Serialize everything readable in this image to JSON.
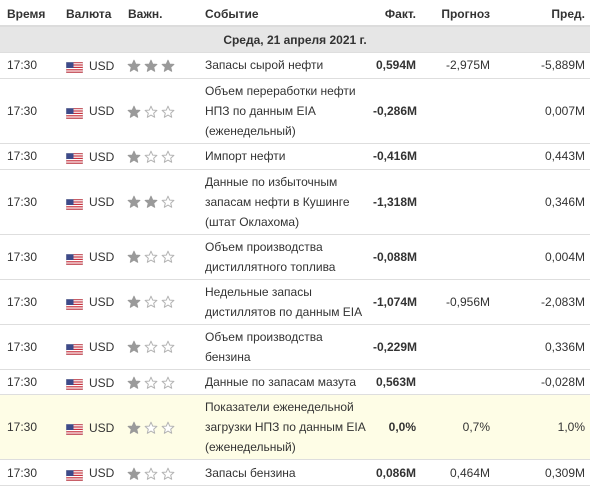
{
  "header": {
    "time": "Время",
    "currency": "Валюта",
    "importance": "Важн.",
    "event": "Событие",
    "actual": "Факт.",
    "forecast": "Прогноз",
    "previous": "Пред."
  },
  "date_label": "Среда, 21 апреля 2021 г.",
  "colors": {
    "positive": "#2c9c14",
    "negative": "#e4141b",
    "neutral": "#111111",
    "highlight_row": "#fefde6",
    "date_bar": "#e6e6e6"
  },
  "events": [
    {
      "time": "17:30",
      "currency": "USD",
      "flag_icon": "us-flag-icon",
      "importance": 3,
      "event": "Запасы сырой нефти",
      "actual": "0,594M",
      "actual_color": "negative",
      "forecast": "-2,975M",
      "previous": "-5,889M",
      "highlighted": false
    },
    {
      "time": "17:30",
      "currency": "USD",
      "flag_icon": "us-flag-icon",
      "importance": 1,
      "event": "Объем переработки нефти НПЗ по данным EIA (еженедельный)",
      "actual": "-0,286M",
      "actual_color": "neutral",
      "forecast": "",
      "previous": "0,007M",
      "highlighted": false
    },
    {
      "time": "17:30",
      "currency": "USD",
      "flag_icon": "us-flag-icon",
      "importance": 1,
      "event": "Импорт нефти",
      "actual": "-0,416M",
      "actual_color": "neutral",
      "forecast": "",
      "previous": "0,443M",
      "highlighted": false
    },
    {
      "time": "17:30",
      "currency": "USD",
      "flag_icon": "us-flag-icon",
      "importance": 2,
      "event": "Данные по избыточным запасам нефти в Кушинге (штат Оклахома)",
      "actual": "-1,318M",
      "actual_color": "neutral",
      "forecast": "",
      "previous": "0,346M",
      "highlighted": false
    },
    {
      "time": "17:30",
      "currency": "USD",
      "flag_icon": "us-flag-icon",
      "importance": 1,
      "event": "Объем производства дистиллятного топлива",
      "actual": "-0,088M",
      "actual_color": "neutral",
      "forecast": "",
      "previous": "0,004M",
      "highlighted": false
    },
    {
      "time": "17:30",
      "currency": "USD",
      "flag_icon": "us-flag-icon",
      "importance": 1,
      "event": "Недельные запасы дистиллятов по данным EIA",
      "actual": "-1,074M",
      "actual_color": "positive",
      "forecast": "-0,956M",
      "previous": "-2,083M",
      "highlighted": false
    },
    {
      "time": "17:30",
      "currency": "USD",
      "flag_icon": "us-flag-icon",
      "importance": 1,
      "event": "Объем производства бензина",
      "actual": "-0,229M",
      "actual_color": "neutral",
      "forecast": "",
      "previous": "0,336M",
      "highlighted": false
    },
    {
      "time": "17:30",
      "currency": "USD",
      "flag_icon": "us-flag-icon",
      "importance": 1,
      "event": "Данные по запасам мазута",
      "actual": "0,563M",
      "actual_color": "neutral",
      "forecast": "",
      "previous": "-0,028M",
      "highlighted": false
    },
    {
      "time": "17:30",
      "currency": "USD",
      "flag_icon": "us-flag-icon",
      "importance": 1,
      "event": "Показатели еженедельной загрузки НПЗ по данным EIA (еженедельный)",
      "actual": "0,0%",
      "actual_color": "negative",
      "forecast": "0,7%",
      "previous": "1,0%",
      "highlighted": true
    },
    {
      "time": "17:30",
      "currency": "USD",
      "flag_icon": "us-flag-icon",
      "importance": 1,
      "event": "Запасы бензина",
      "actual": "0,086M",
      "actual_color": "positive",
      "forecast": "0,464M",
      "previous": "0,309M",
      "highlighted": false
    }
  ]
}
